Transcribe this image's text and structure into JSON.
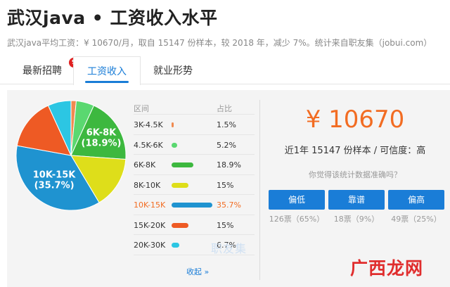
{
  "page": {
    "title": "武汉java • 工资收入水平",
    "subtitle": "武汉java平均工资：¥ 10670/月，取自 15147 份样本，较 2018 年，减少 7%。统计来自职友集（jobui.com）"
  },
  "tabs": [
    {
      "label": "最新招聘",
      "badge": "99+"
    },
    {
      "label": "工资收入"
    },
    {
      "label": "就业形势"
    }
  ],
  "table": {
    "col_range": "区间",
    "col_pct": "占比",
    "collapse": "收起 »"
  },
  "chart_data": {
    "type": "pie",
    "categories": [
      "3K-4.5K",
      "4.5K-6K",
      "6K-8K",
      "8K-10K",
      "10K-15K",
      "15K-20K",
      "20K-30K"
    ],
    "values": [
      1.5,
      5.2,
      18.9,
      15,
      35.7,
      15,
      6.7
    ],
    "labels": [
      "1.5%",
      "5.2%",
      "18.9%",
      "15%",
      "35.7%",
      "15%",
      "6.7%"
    ],
    "colors": [
      "#f08a50",
      "#5ad870",
      "#3db83f",
      "#dede1a",
      "#1f93d0",
      "#ee5a24",
      "#2cc6e3"
    ],
    "highlight": "10K-15K",
    "pie_callouts": [
      {
        "category": "10K-15K",
        "line1": "10K-15K",
        "line2": "(35.7%)"
      },
      {
        "category": "6K-8K",
        "line1": "6K-8K",
        "line2": "(18.9%)"
      }
    ]
  },
  "summary": {
    "amount": "¥ 10670",
    "samples": "近1年 15147 份样本 / 可信度：高",
    "question": "你觉得该统计数据准确吗？",
    "votes": [
      {
        "label": "偏低",
        "count": "126票（65%）"
      },
      {
        "label": "靠谱",
        "count": "18票（9%）"
      },
      {
        "label": "偏高",
        "count": "49票（25%）"
      }
    ]
  },
  "watermark": "职友集",
  "brand": "广西龙网"
}
